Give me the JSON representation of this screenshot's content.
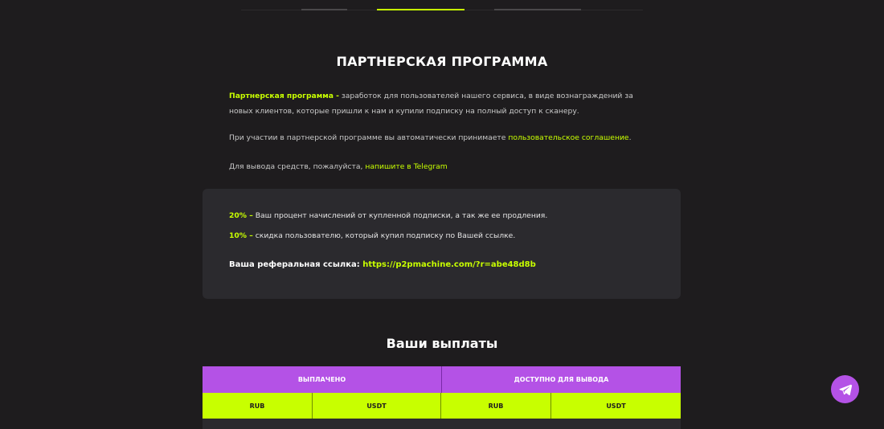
{
  "nav": {
    "tabs": [
      {
        "label": "",
        "active": false
      },
      {
        "label": "",
        "active": true
      },
      {
        "label": "",
        "active": false
      }
    ]
  },
  "page": {
    "title": "ПАРТНЕРСКАЯ ПРОГРАММА",
    "intro_highlight": "Партнерская программа -",
    "intro_text": " заработок для пользователей нашего сервиса, в виде вознаграждений за новых клиентов, которые пришли к нам и купили подписку на полный доступ к сканеру.",
    "agreement_text": "При участии в партнерской программе вы автоматически принимаете ",
    "agreement_link": "пользовательское соглашение",
    "agreement_end": ".",
    "withdraw_text": "Для вывода средств, пожалуйста, ",
    "withdraw_link": "напишите в Telegram"
  },
  "card": {
    "pct1": "20% –",
    "pct1_text": " Ваш процент начислений от купленной подписки, а так же ее продления.",
    "pct2": "10% –",
    "pct2_text": " скидка пользователю, который купил подписку по Вашей ссылке.",
    "ref_label": "Ваша реферальная ссылка: ",
    "ref_link": "https://p2pmachine.com/?r=abe48d8b"
  },
  "payouts": {
    "title": "Ваши выплаты",
    "headers": [
      "Выплачено",
      "Доступно для вывода"
    ],
    "subheaders": [
      "RUB",
      "USDT",
      "RUB",
      "USDT"
    ]
  },
  "colors": {
    "accent_green": "#c8ff00",
    "accent_purple": "#b452e6",
    "background": "#1e1c1e",
    "card": "#2b2a2e"
  },
  "icons": {
    "telegram": "telegram-icon"
  }
}
